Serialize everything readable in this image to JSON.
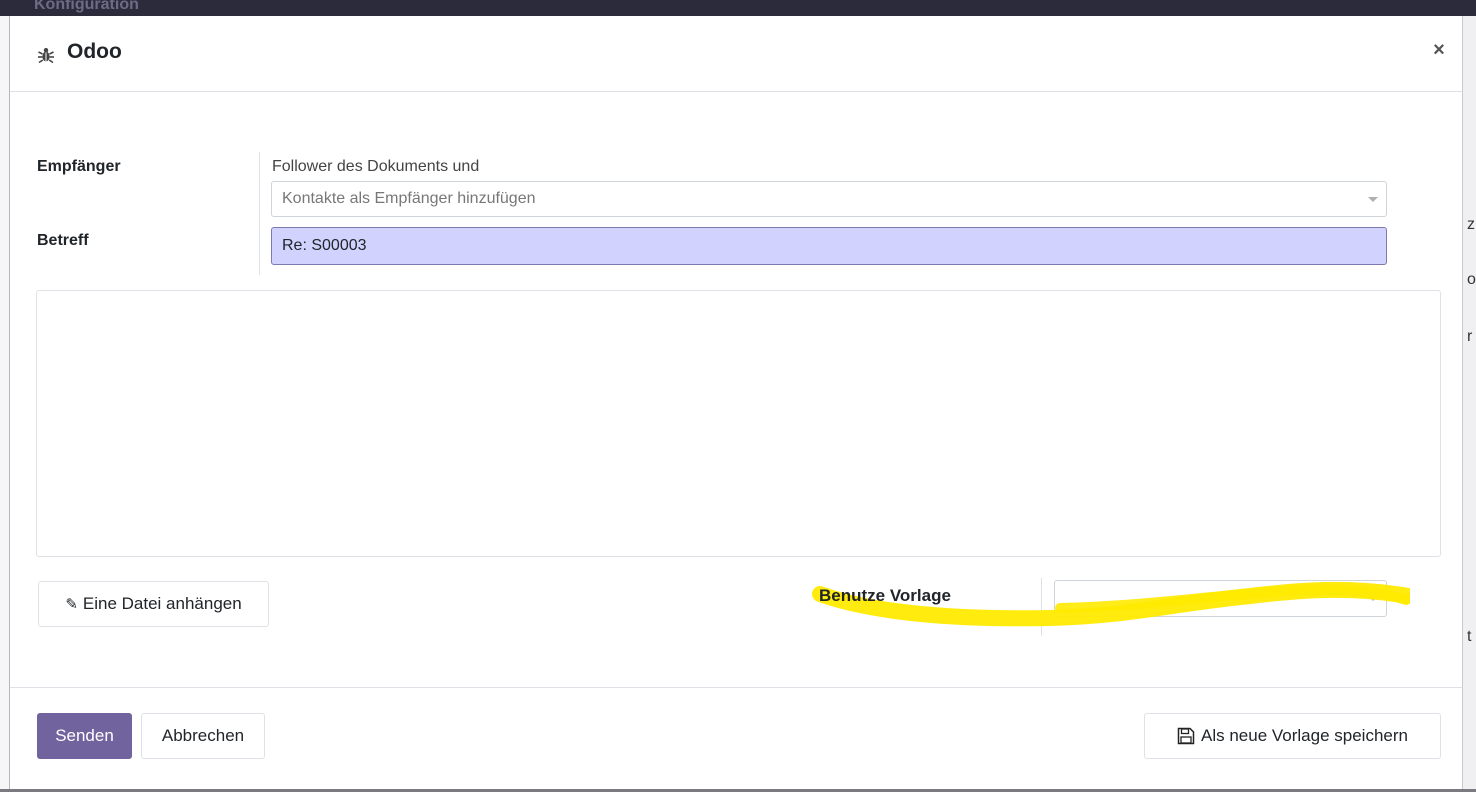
{
  "background": {
    "top_text": "Konfiguration",
    "right_chars": [
      "z",
      "o",
      "r",
      "t"
    ]
  },
  "modal": {
    "title": "Odoo",
    "close_label": "×"
  },
  "form": {
    "recipients_label": "Empfänger",
    "recipients_text": "Follower des Dokuments und",
    "recipients_placeholder": "Kontakte als Empfänger hinzufügen",
    "subject_label": "Betreff",
    "subject_value": "Re: S00003",
    "template_label": "Benutze Vorlage",
    "template_value": ""
  },
  "buttons": {
    "attach_label": "Eine Datei anhängen",
    "send_label": "Senden",
    "cancel_label": "Abbrechen",
    "save_template_label": "Als neue Vorlage speichern"
  },
  "colors": {
    "primary": "#71639e",
    "subject_bg": "#d2d2ff",
    "highlight": "#ffea00"
  },
  "icons": {
    "title_icon": "bug-icon",
    "attach_icon": "paperclip-icon",
    "save_icon": "floppy-disk-icon"
  }
}
